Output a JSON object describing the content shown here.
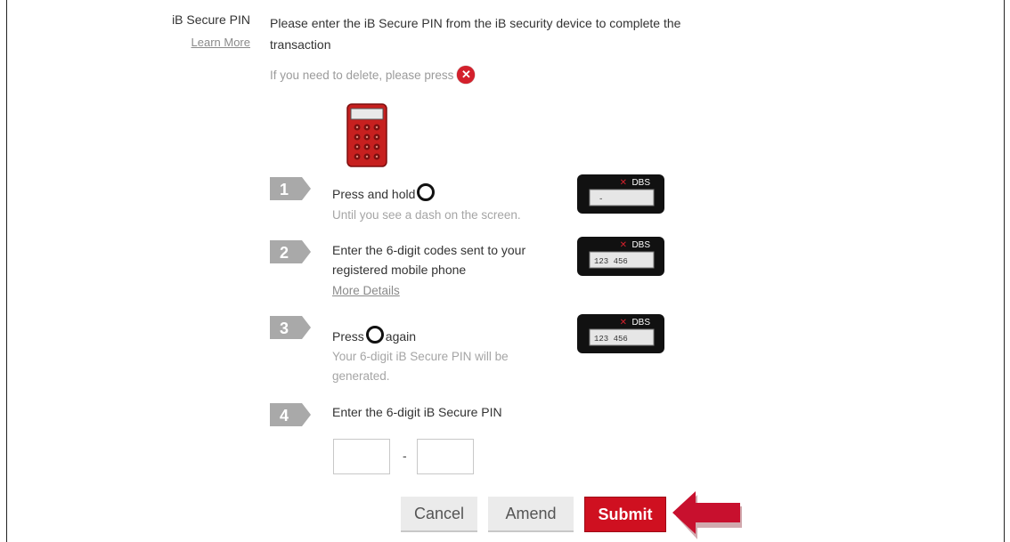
{
  "pin_section": {
    "label": "iB Secure PIN",
    "learn_more": "Learn More",
    "instruction": "Please enter the iB Secure PIN from the iB security device to complete the transaction",
    "delete_note": "If you need to delete, please press"
  },
  "steps": [
    {
      "number": "1",
      "title_before": "Press and hold",
      "title_after": "",
      "subtitle": "Until you see a dash on the screen.",
      "token_brand": "DBS",
      "token_display": "-"
    },
    {
      "number": "2",
      "title": "Enter the 6-digit codes sent to your registered mobile phone",
      "link": "More Details",
      "token_brand": "DBS",
      "token_display": "123 456"
    },
    {
      "number": "3",
      "title_before": "Press",
      "title_after": "again",
      "subtitle": "Your 6-digit iB Secure PIN will be generated.",
      "token_brand": "DBS",
      "token_display": "123 456"
    },
    {
      "number": "4",
      "title": "Enter the 6-digit iB Secure PIN",
      "separator": "-"
    }
  ],
  "pin_inputs": {
    "first": "",
    "second": ""
  },
  "buttons": {
    "cancel": "Cancel",
    "amend": "Amend",
    "submit": "Submit"
  },
  "colors": {
    "brand_red": "#cf1020",
    "arrow_red": "#c8102e",
    "badge_grey": "#a9a9a9"
  },
  "icons": {
    "delete": "x-circle-icon",
    "ring": "ring-button-icon",
    "arrow": "left-arrow-icon"
  }
}
